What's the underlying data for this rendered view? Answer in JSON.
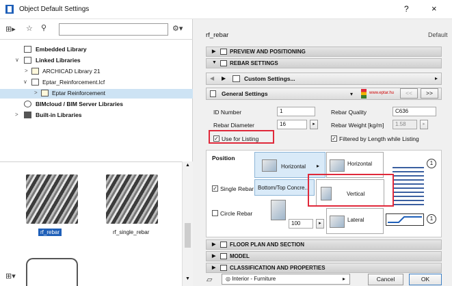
{
  "window": {
    "title": "Object Default Settings",
    "help_glyph": "?",
    "close_glyph": "×"
  },
  "library": {
    "search_placeholder": "",
    "tree": [
      {
        "label": "Embedded Library",
        "bold": true,
        "arrow": "",
        "icon": "page-icon"
      },
      {
        "label": "Linked Libraries",
        "bold": true,
        "arrow": "∨",
        "icon": "linked-library-icon"
      },
      {
        "label": "ARCHICAD Library 21",
        "bold": false,
        "arrow": ">",
        "icon": "folder-icon"
      },
      {
        "label": "Eptar_Reinforcement.lcf",
        "bold": false,
        "arrow": "∨",
        "icon": "container-icon"
      },
      {
        "label": "Eptar Reinforcement",
        "bold": false,
        "arrow": ">",
        "icon": "folder-icon"
      },
      {
        "label": "BIMcloud / BIM Server Libraries",
        "bold": true,
        "arrow": "",
        "icon": "cloud-icon"
      },
      {
        "label": "Built-in Libraries",
        "bold": true,
        "arrow": ">",
        "icon": "folder-icon"
      }
    ],
    "thumbs": [
      {
        "label": "rf_rebar",
        "selected": true
      },
      {
        "label": "rf_single_rebar",
        "selected": false
      }
    ]
  },
  "object": {
    "name": "rf_rebar",
    "default_label": "Default"
  },
  "sections": {
    "preview": "PREVIEW AND POSITIONING",
    "rebar_settings": "REBAR SETTINGS",
    "floor_plan": "FLOOR PLAN AND SECTION",
    "model": "MODEL",
    "classification": "CLASSIFICATION AND PROPERTIES"
  },
  "custom_settings": {
    "label": "Custom Settings..."
  },
  "general_settings": {
    "label": "General Settings",
    "nav_prev": "<<",
    "nav_next": ">>",
    "logo_text": "www.eptar.hu"
  },
  "fields": {
    "id_label": "ID Number",
    "id_value": "1",
    "diameter_label": "Rebar Diameter",
    "diameter_value": "16",
    "quality_label": "Rebar Quality",
    "quality_value": "C636",
    "weight_label": "Rebar Weight [kg/m]",
    "weight_value": "1.58",
    "use_listing_label": "Use for Listing",
    "filtered_label": "Filtered by Length while Listing"
  },
  "position": {
    "label": "Position",
    "horizontal_selected": "Horizontal",
    "horizontal_option": "Horizontal",
    "vertical_option": "Vertical",
    "lateral_option": "Lateral",
    "single_rebar_label": "Single Rebar",
    "circle_rebar_label": "Circle Rebar",
    "bottom_top_label": "Bottom/Top Concre...",
    "spacing_value": "100",
    "circle_num_1": "1",
    "circle_num_2": "1"
  },
  "footer": {
    "layer_value": "Interior - Furniture",
    "cancel": "Cancel",
    "ok": "OK"
  },
  "colors": {
    "accent": "#1e5fb8",
    "highlight_box": "#e0283a",
    "tile_blue": "#d9eaf8"
  }
}
